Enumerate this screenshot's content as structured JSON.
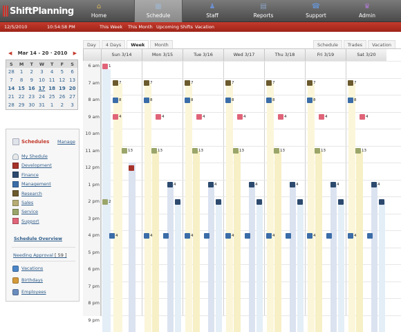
{
  "app": {
    "logo_text": "ShiftPlanning"
  },
  "nav": {
    "tabs": [
      {
        "label": "Home",
        "icon": "home-icon"
      },
      {
        "label": "Schedule",
        "icon": "calendar-icon"
      },
      {
        "label": "Staff",
        "icon": "staff-icon"
      },
      {
        "label": "Reports",
        "icon": "reports-icon"
      },
      {
        "label": "Support",
        "icon": "support-icon"
      },
      {
        "label": "Admin",
        "icon": "admin-icon"
      }
    ],
    "active": "Schedule"
  },
  "subbar": {
    "date": "12/5/2010",
    "time": "10:54:58 PM",
    "links": [
      "This Week",
      "This Month",
      "Upcoming Shifts",
      "Vacation"
    ]
  },
  "mini_calendar": {
    "title": "Mar 14 - 20 · 2010",
    "prev_icon": "prev-arrow-icon",
    "next_icon": "next-arrow-icon",
    "weekdays": [
      "S",
      "M",
      "T",
      "W",
      "T",
      "F",
      "S"
    ],
    "weeks": [
      [
        "28",
        "1",
        "2",
        "3",
        "4",
        "5",
        "6"
      ],
      [
        "7",
        "8",
        "9",
        "10",
        "11",
        "12",
        "13"
      ],
      [
        "14",
        "15",
        "16",
        "17",
        "18",
        "19",
        "20"
      ],
      [
        "21",
        "22",
        "23",
        "24",
        "25",
        "26",
        "27"
      ],
      [
        "28",
        "29",
        "30",
        "31",
        "1",
        "2",
        "3"
      ]
    ]
  },
  "schedules": {
    "title": "Schedules",
    "manage": "Manage",
    "items": [
      {
        "label": "My Shedule",
        "color": "#e8e8e8",
        "icon": "person-icon"
      },
      {
        "label": "Development",
        "color": "#a6322a"
      },
      {
        "label": "Finance",
        "color": "#2d4a6e"
      },
      {
        "label": "Management",
        "color": "#3a6ca8"
      },
      {
        "label": "Research",
        "color": "#6b5a2e"
      },
      {
        "label": "Sales",
        "color": "#b7ad74"
      },
      {
        "label": "Service",
        "color": "#9aa56a"
      },
      {
        "label": "Support",
        "color": "#e06478"
      }
    ],
    "overview": "Schedule Overview",
    "needing_approval": "Needing Approval",
    "needing_count": "[ 59 ]",
    "links": [
      {
        "label": "Vacations",
        "icon": "vacation-icon"
      },
      {
        "label": "Birthdays",
        "icon": "birthday-icon"
      },
      {
        "label": "Employees",
        "icon": "employees-icon"
      }
    ]
  },
  "view_tabs": [
    "Day",
    "4 Days",
    "Week",
    "Month"
  ],
  "active_view": "Week",
  "right_tabs": [
    "Schedule",
    "Trades",
    "Vacation"
  ],
  "days": [
    "Sun 3/14",
    "Mon 3/15",
    "Tue 3/16",
    "Wed 3/17",
    "Thu 3/18",
    "Fri 3/19",
    "Sat 3/20"
  ],
  "hours": [
    "6 am",
    "7 am",
    "8 am",
    "9 am",
    "10 am",
    "11 am",
    "12 pm",
    "1 pm",
    "2 pm",
    "3 pm",
    "4 pm",
    "5 pm",
    "6 pm",
    "7 pm",
    "8 pm",
    "9 pm"
  ],
  "shift_labels": {
    "s1": "1",
    "s2": "7",
    "s3": "8",
    "s4": "4",
    "s5": "13",
    "s6": "2",
    "s7": "4"
  }
}
